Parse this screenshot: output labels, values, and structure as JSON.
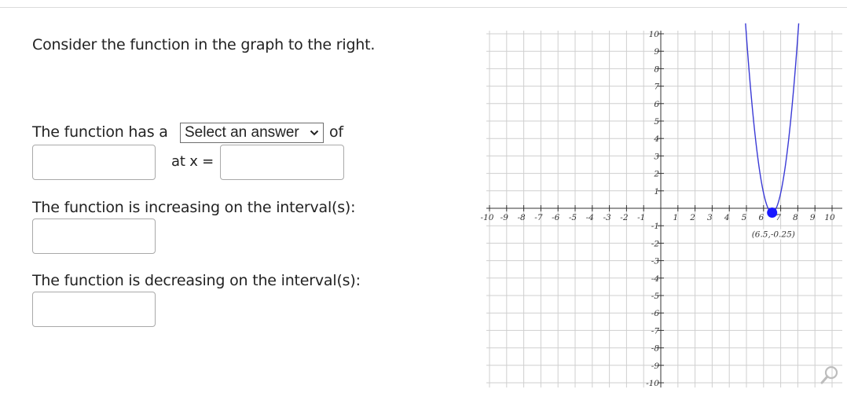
{
  "question": {
    "prompt": "Consider the function in the graph to the right.",
    "line1_prefix": "The function has a",
    "select": {
      "value": "Select an answer",
      "icon": "chevron-down-icon"
    },
    "line1_suffix": "of",
    "at_x_label": "at x =",
    "increasing_label": "The function is increasing on the interval(s):",
    "decreasing_label": "The function is decreasing on the interval(s):",
    "inputs": {
      "extreme_value": "",
      "x_value": "",
      "increasing": "",
      "decreasing": ""
    }
  },
  "graph": {
    "x_ticks": [
      "-10",
      "-9",
      "-8",
      "-7",
      "-6",
      "-5",
      "-4",
      "-3",
      "-2",
      "-1",
      "1",
      "2",
      "3",
      "4",
      "5",
      "6",
      "7",
      "8",
      "9",
      "10"
    ],
    "y_ticks": [
      "10",
      "9",
      "8",
      "7",
      "6",
      "5",
      "4",
      "3",
      "2",
      "1",
      "-1",
      "-2",
      "-3",
      "-4",
      "-5",
      "-6",
      "-7",
      "-8",
      "-9",
      "-10"
    ],
    "vertex_label": "(6.5,-0.25)",
    "zoom_icon": "magnify-icon"
  },
  "chart_data": {
    "type": "line",
    "series": [
      {
        "curve": "parabola",
        "points": [
          [
            4.2,
            10
          ],
          [
            5,
            5
          ],
          [
            5.5,
            2
          ],
          [
            6,
            0.5
          ],
          [
            6.5,
            -0.25
          ],
          [
            7,
            0.5
          ],
          [
            7.5,
            2
          ],
          [
            8,
            5
          ],
          [
            8.8,
            10
          ]
        ]
      }
    ],
    "highlighted_point": {
      "x": 6.5,
      "y": -0.25,
      "label": "(6.5,-0.25)"
    },
    "xlim": [
      -10,
      10
    ],
    "ylim": [
      -10,
      10
    ],
    "grid": true,
    "colors": {
      "curve": "#3a3ad6",
      "point": "#1a1aff"
    }
  }
}
